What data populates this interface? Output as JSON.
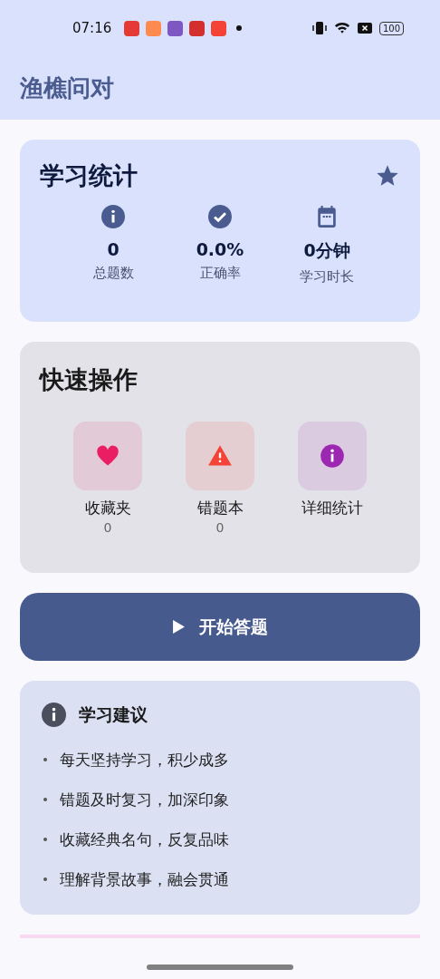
{
  "status_bar": {
    "time": "07:16",
    "notification_icons": [
      {
        "color": "#e53935"
      },
      {
        "color": "#ff8a50"
      },
      {
        "color": "#7e57c2"
      },
      {
        "color": "#d32f2f"
      },
      {
        "color": "#f44336"
      }
    ],
    "battery": "100"
  },
  "app_bar": {
    "title": "渔樵问对"
  },
  "stats_card": {
    "title": "学习统计",
    "stats": [
      {
        "kind": "info",
        "value": "0",
        "label": "总题数"
      },
      {
        "kind": "check",
        "value": "0.0%",
        "label": "正确率"
      },
      {
        "kind": "calendar",
        "value": "0分钟",
        "label": "学习时长"
      }
    ]
  },
  "quick_actions": {
    "title": "快速操作",
    "items": [
      {
        "kind": "heart",
        "color": "#e91e63",
        "label": "收藏夹",
        "count": "0"
      },
      {
        "kind": "warning",
        "color": "#f44336",
        "label": "错题本",
        "count": "0"
      },
      {
        "kind": "info",
        "color": "#9c27b0",
        "label": "详细统计"
      }
    ]
  },
  "start_button": {
    "label": "开始答题"
  },
  "tips": {
    "title": "学习建议",
    "items": [
      "每天坚持学习，积少成多",
      "错题及时复习，加深印象",
      "收藏经典名句，反复品味",
      "理解背景故事，融会贯通"
    ]
  }
}
